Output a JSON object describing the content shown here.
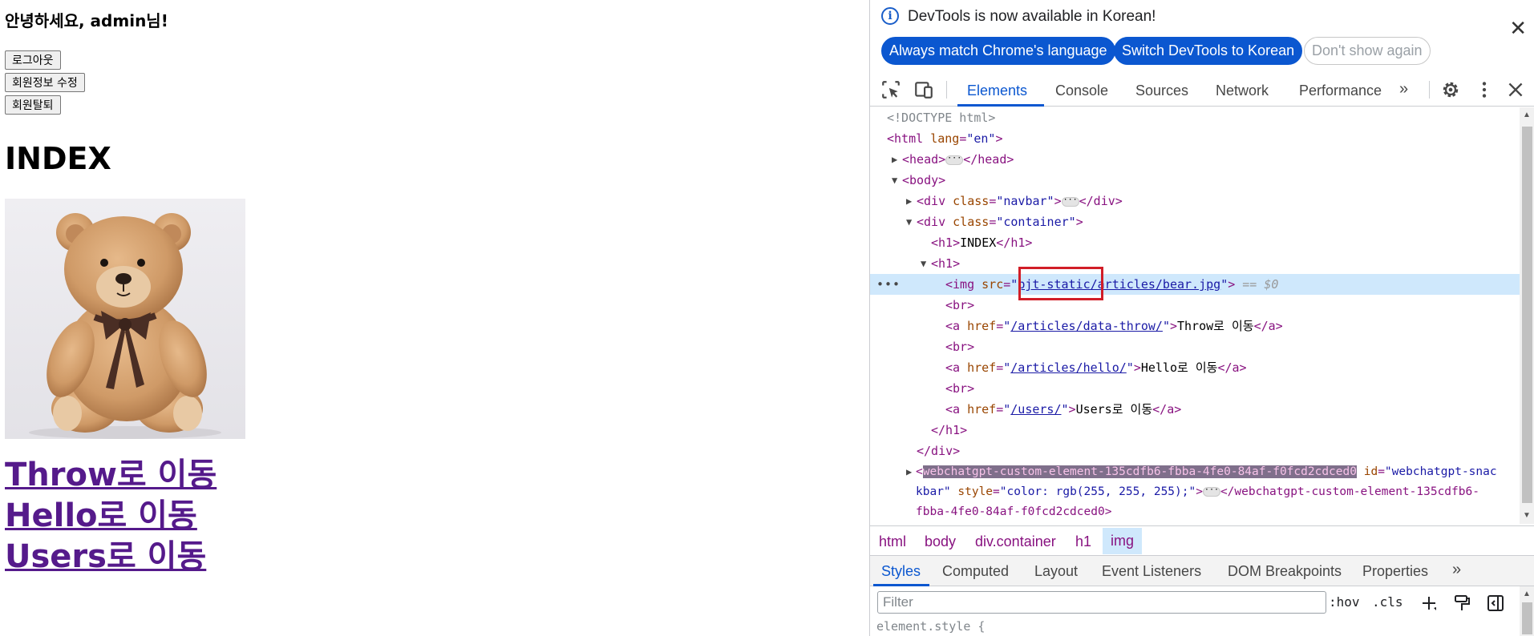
{
  "page": {
    "greeting": "안녕하세요, admin님!",
    "buttons": {
      "logout": "로그아웃",
      "edit_profile": "회원정보 수정",
      "withdraw": "회원탈퇴"
    },
    "heading": "INDEX",
    "links": {
      "throw": "Throw로 이동",
      "hello": "Hello로 이동",
      "users": "Users로 이동"
    }
  },
  "devtools": {
    "infobar": {
      "message": "DevTools is now available in Korean!",
      "match_language": "Always match Chrome's language",
      "switch_korean": "Switch DevTools to Korean",
      "dont_show": "Don't show again"
    },
    "tabs": {
      "elements": "Elements",
      "console": "Console",
      "sources": "Sources",
      "network": "Network",
      "performance": "Performance"
    },
    "dom": {
      "doctype": "<!DOCTYPE html>",
      "html_open": "<html",
      "lang_attr": "lang",
      "lang_val": "\"en\"",
      "gt": ">",
      "head_open": "<head>",
      "head_close": "</head>",
      "body_open": "<body>",
      "div_open": "<div",
      "class_attr": "class",
      "navbar_val": "\"navbar\"",
      "div_close": "</div>",
      "container_val": "\"container\"",
      "h1_index": "<h1>",
      "index_text": "INDEX",
      "h1_close": "</h1>",
      "h1_open": "<h1>",
      "img_open": "<img",
      "src_attr": "src",
      "q": "\"",
      "src_val": "pjt-static/articles/bear.jpg",
      "dollar_zero": "== $0",
      "br": "<br>",
      "a_open": "<a",
      "href_attr": "href",
      "href_throw": "/articles/data-throw/",
      "text_throw": "Throw로 이동",
      "href_hello": "/articles/hello/",
      "text_hello": "Hello로 이동",
      "href_users": "/users/",
      "text_users": "Users로 이동",
      "a_close": "</a>",
      "custom_tag": "webchatgpt-custom-element-135cdfb6-fbba-4fe0-84af-f0fcd2cdced0",
      "id_attr": "id",
      "id_val_1": "\"webchatgpt-snac",
      "id_val_2": "kbar\"",
      "style_attr": "style",
      "style_val": "\"color: rgb(255, 255, 255);\"",
      "custom_close_1": "</webchatgpt-custom-element-135cdfb6-",
      "custom_close_2": "fbba-4fe0-84af-f0fcd2cdced0>",
      "lt": "<",
      "eq": "="
    },
    "breadcrumb": {
      "html": "html",
      "body": "body",
      "container": "div.container",
      "h1": "h1",
      "img": "img"
    },
    "subtabs": {
      "styles": "Styles",
      "computed": "Computed",
      "layout": "Layout",
      "listeners": "Event Listeners",
      "dom_bp": "DOM Breakpoints",
      "properties": "Properties"
    },
    "filter": {
      "placeholder": "Filter",
      "hov": ":hov",
      "cls": ".cls"
    },
    "element_style": "element.style {"
  }
}
